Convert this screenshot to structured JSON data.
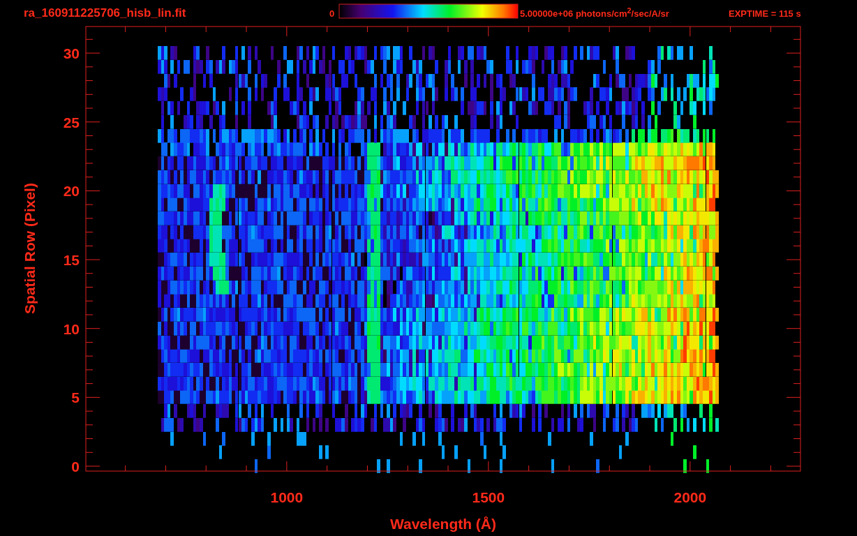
{
  "plot": {
    "title": "ra_160911225706_hisb_lin.fit",
    "colorbar": {
      "min_label": "0",
      "max_label": "5.00000e+06 photons/cm$^{2}$/sec/A/sr"
    },
    "exposure": "EXPTIME = 115 s",
    "x_axis": {
      "title": "Wavelength (Å)",
      "tick_labels": [
        "1000",
        "1500",
        "2000"
      ]
    },
    "y_axis": {
      "title": "Spatial Row (Pixel)",
      "tick_labels": [
        "30",
        "25",
        "20",
        "15",
        "10",
        "5",
        "0"
      ]
    }
  }
}
